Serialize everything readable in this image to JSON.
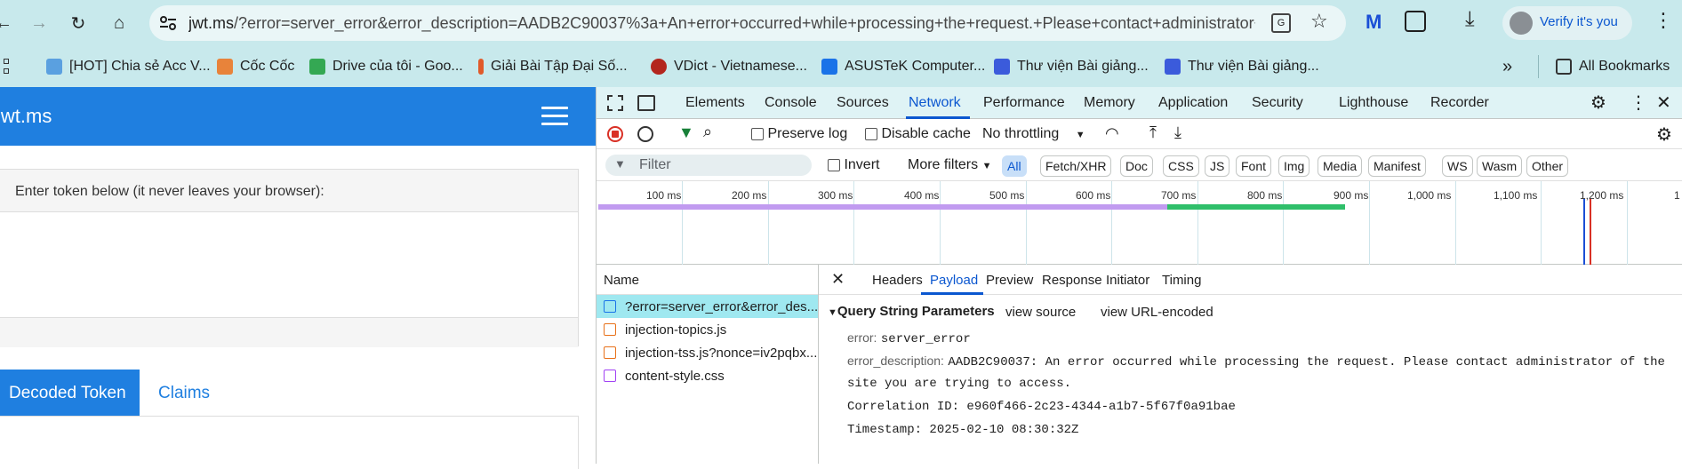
{
  "browser": {
    "url_host": "jwt.ms",
    "url_rest": "/?error=server_error&error_description=AADB2C90037%3a+An+error+occurred+while+processing+the+request.+Please+contact+administrator+...",
    "profile_label": "Verify it's you",
    "bookmarks": [
      {
        "label": "[HOT] Chia sẻ Acc V...",
        "color": "#5aa0e0"
      },
      {
        "label": "Cốc Cốc",
        "color": "#e8833a"
      },
      {
        "label": "Drive của tôi - Goo...",
        "color": "#34a853"
      },
      {
        "label": "Giải Bài Tập Đại Số...",
        "color": "#e05a2a"
      },
      {
        "label": "VDict - Vietnamese...",
        "color": "#b3261e"
      },
      {
        "label": "ASUSTeK Computer...",
        "color": "#1a73e8"
      },
      {
        "label": "Thư viện Bài giảng...",
        "color": "#3b5bdb"
      },
      {
        "label": "Thư viện Bài giảng...",
        "color": "#3b5bdb"
      }
    ],
    "all_bookmarks": "All Bookmarks",
    "overflow": "»"
  },
  "page": {
    "brand": "jwt.ms",
    "token_prompt": "Enter token below (it never leaves your browser):",
    "tab_decoded": "Decoded Token",
    "tab_claims": "Claims"
  },
  "devtools": {
    "tabs": [
      "Elements",
      "Console",
      "Sources",
      "Network",
      "Performance",
      "Memory",
      "Application",
      "Security",
      "Lighthouse",
      "Recorder"
    ],
    "preserve_log": "Preserve log",
    "disable_cache": "Disable cache",
    "throttling": "No throttling",
    "filter_placeholder": "Filter",
    "invert": "Invert",
    "more_filters": "More filters",
    "chips": [
      "All",
      "Fetch/XHR",
      "Doc",
      "CSS",
      "JS",
      "Font",
      "Img",
      "Media",
      "Manifest",
      "WS",
      "Wasm",
      "Other"
    ],
    "timeline_ticks": [
      "100 ms",
      "200 ms",
      "300 ms",
      "400 ms",
      "500 ms",
      "600 ms",
      "700 ms",
      "800 ms",
      "900 ms",
      "1,000 ms",
      "1,100 ms",
      "1,200 ms",
      "1"
    ],
    "name_header": "Name",
    "requests": [
      {
        "name": "?error=server_error&error_des...",
        "color": "#1a73e8"
      },
      {
        "name": "injection-topics.js",
        "color": "#e8711a"
      },
      {
        "name": "injection-tss.js?nonce=iv2pqbx...",
        "color": "#e8711a"
      },
      {
        "name": "content-style.css",
        "color": "#a142f4"
      }
    ],
    "detail_tabs": [
      "Headers",
      "Payload",
      "Preview",
      "Response",
      "Initiator",
      "Timing"
    ],
    "payload": {
      "section_title": "Query String Parameters",
      "view_source": "view source",
      "view_url_encoded": "view URL-encoded",
      "error_key": "error:",
      "error_val": "server_error",
      "desc_key": "error_description:",
      "desc_line1": "AADB2C90037: An error occurred while processing the request. Please contact administrator of the",
      "desc_line2": "site you are trying to access.",
      "correlation": "Correlation ID: e960f466-2c23-4344-a1b7-5f67f0a91bae",
      "timestamp": "Timestamp: 2025-02-10 08:30:32Z"
    }
  }
}
